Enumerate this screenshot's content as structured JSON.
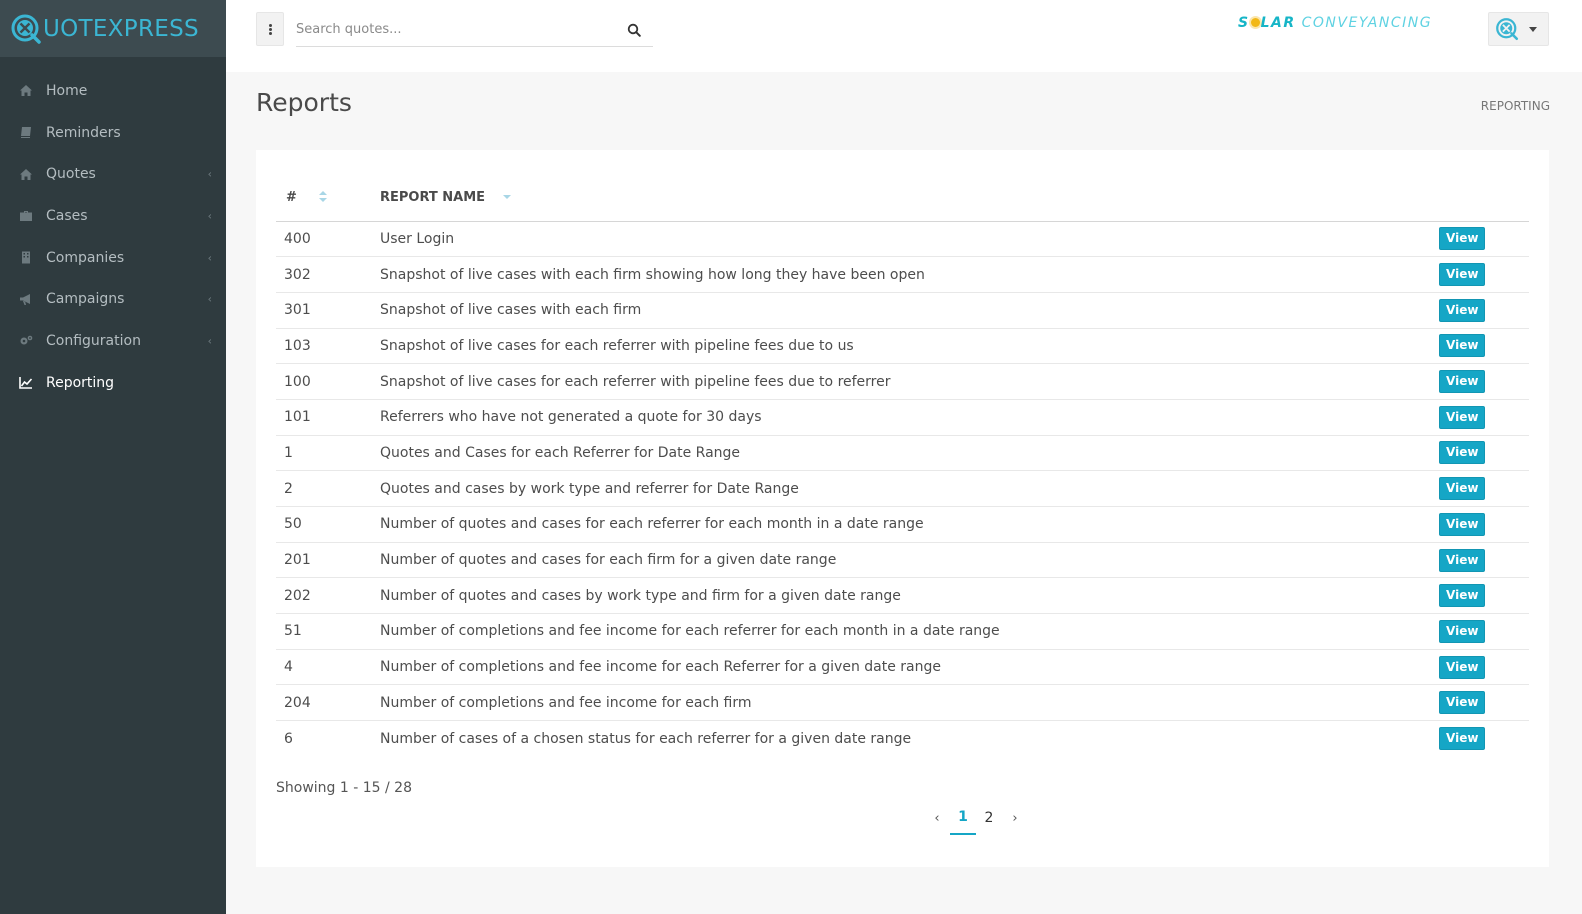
{
  "app": {
    "brand_prefix": "UOTE",
    "brand_suffix": "XPRESS",
    "accent_color": "#15a6c6",
    "sidebar_color": "#2f3b3f"
  },
  "sidebar": {
    "items": [
      {
        "label": "Home",
        "icon": "home-icon",
        "has_submenu": false
      },
      {
        "label": "Reminders",
        "icon": "book-icon",
        "has_submenu": false
      },
      {
        "label": "Quotes",
        "icon": "home-icon",
        "has_submenu": true
      },
      {
        "label": "Cases",
        "icon": "briefcase-icon",
        "has_submenu": true
      },
      {
        "label": "Companies",
        "icon": "building-icon",
        "has_submenu": true
      },
      {
        "label": "Campaigns",
        "icon": "megaphone-icon",
        "has_submenu": true
      },
      {
        "label": "Configuration",
        "icon": "gears-icon",
        "has_submenu": true
      },
      {
        "label": "Reporting",
        "icon": "line-chart-icon",
        "has_submenu": false,
        "active": true
      }
    ]
  },
  "topbar": {
    "search_placeholder": "Search quotes...",
    "company_logo": {
      "part1": "S",
      "part2": "LAR",
      "part3": "CONVEYANCING"
    }
  },
  "page": {
    "title": "Reports",
    "breadcrumb": "REPORTING"
  },
  "table": {
    "columns": {
      "id": "#",
      "name": "REPORT NAME"
    },
    "action_label": "View",
    "rows": [
      {
        "id": "400",
        "name": "User Login"
      },
      {
        "id": "302",
        "name": "Snapshot of live cases with each firm showing how long they have been open"
      },
      {
        "id": "301",
        "name": "Snapshot of live cases with each firm"
      },
      {
        "id": "103",
        "name": "Snapshot of live cases for each referrer with pipeline fees due to us"
      },
      {
        "id": "100",
        "name": "Snapshot of live cases for each referrer with pipeline fees due to referrer"
      },
      {
        "id": "101",
        "name": "Referrers who have not generated a quote for 30 days"
      },
      {
        "id": "1",
        "name": "Quotes and Cases for each Referrer for Date Range"
      },
      {
        "id": "2",
        "name": "Quotes and cases by work type and referrer for Date Range"
      },
      {
        "id": "50",
        "name": "Number of quotes and cases for each referrer for each month in a date range"
      },
      {
        "id": "201",
        "name": "Number of quotes and cases for each firm for a given date range"
      },
      {
        "id": "202",
        "name": "Number of quotes and cases by work type and firm for a given date range"
      },
      {
        "id": "51",
        "name": "Number of completions and fee income for each referrer for each month in a date range"
      },
      {
        "id": "4",
        "name": "Number of completions and fee income for each Referrer for a given date range"
      },
      {
        "id": "204",
        "name": "Number of completions and fee income for each firm"
      },
      {
        "id": "6",
        "name": "Number of cases of a chosen status for each referrer for a given date range"
      }
    ]
  },
  "pagination": {
    "showing": "Showing 1 - 15 / 28",
    "pages": [
      "1",
      "2"
    ],
    "current": "1"
  }
}
